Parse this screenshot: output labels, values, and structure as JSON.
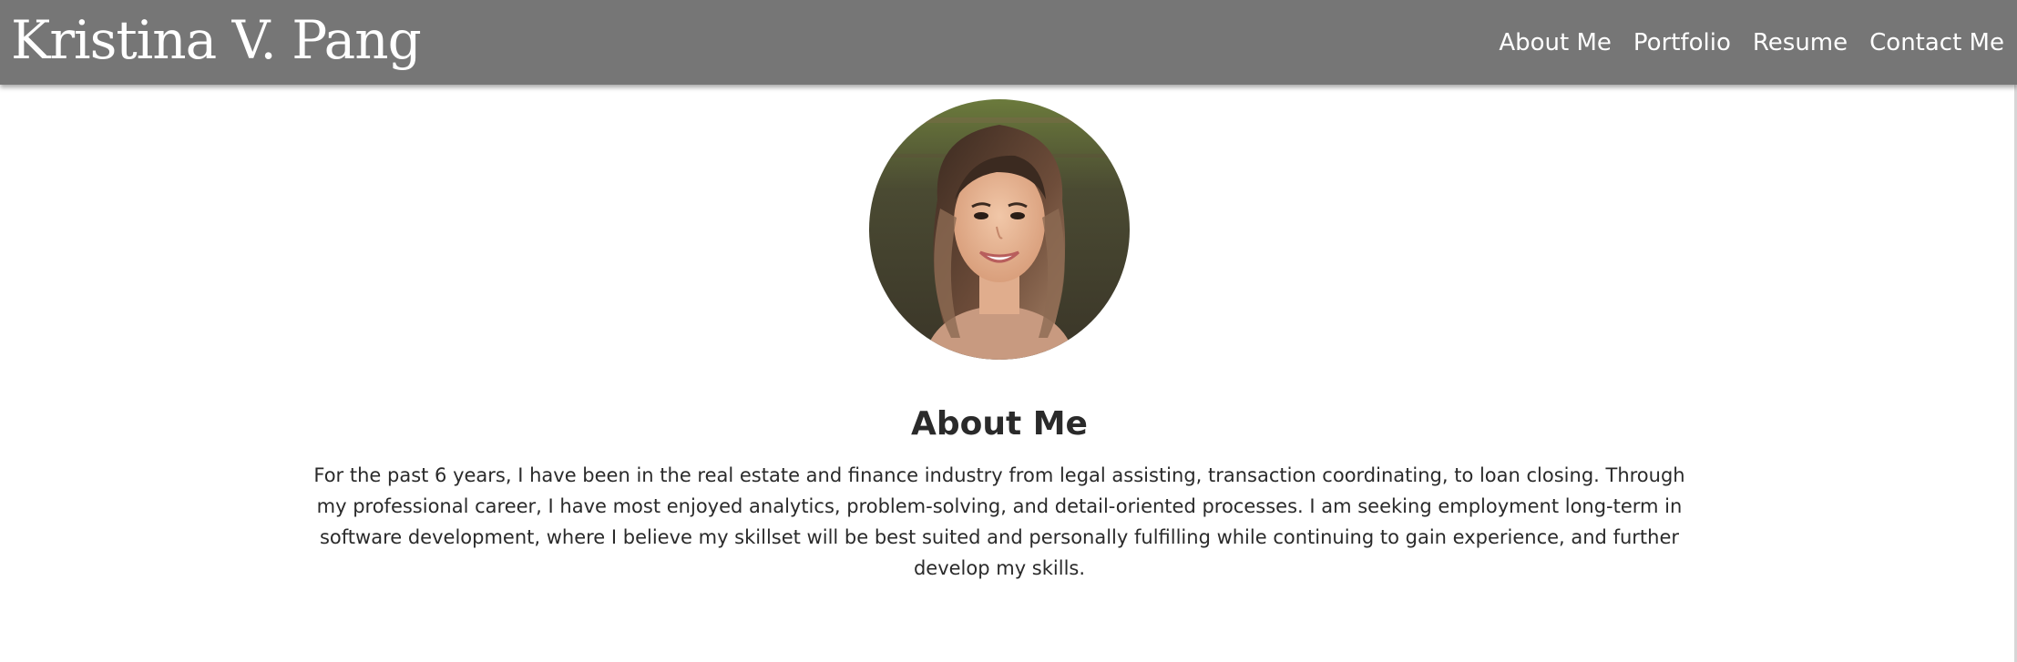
{
  "header": {
    "brand": "Kristina V. Pang",
    "nav": [
      {
        "label": "About Me"
      },
      {
        "label": "Portfolio"
      },
      {
        "label": "Resume"
      },
      {
        "label": "Contact Me"
      }
    ]
  },
  "about": {
    "title": "About Me",
    "body": "For the past 6 years, I have been in the real estate and finance industry from legal assisting, transaction coordinating, to loan closing. Through my professional career, I have most enjoyed analytics, problem-solving, and detail-oriented processes. I am seeking employment long-term in software development, where I believe my skillset will be best suited and personally fulfilling while continuing to gain experience, and further develop my skills."
  },
  "colors": {
    "navbar": "#767676",
    "text": "#2a2a2a",
    "nav_text": "#ffffff"
  }
}
